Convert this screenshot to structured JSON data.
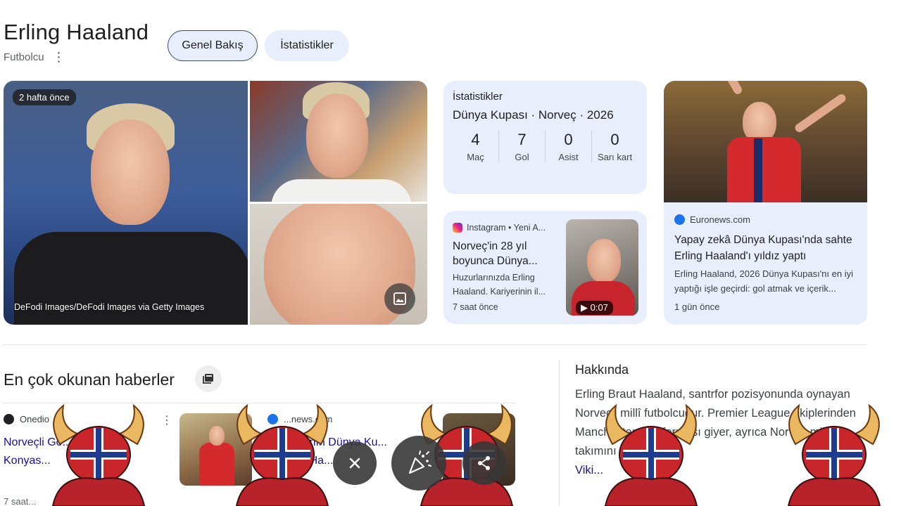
{
  "header": {
    "title": "Erling Haaland",
    "subtitle": "Futbolcu",
    "tabs": [
      {
        "label": "Genel Bakış",
        "active": true
      },
      {
        "label": "İstatistikler",
        "active": false
      }
    ]
  },
  "photos": {
    "time_badge": "2 hafta önce",
    "credit": "DeFodi Images/DeFodi Images via Getty Images"
  },
  "stats": {
    "heading": "İstatistikler",
    "context": "Dünya Kupası · Norveç · 2026",
    "items": [
      {
        "value": "4",
        "label": "Maç"
      },
      {
        "value": "7",
        "label": "Gol"
      },
      {
        "value": "0",
        "label": "Asist"
      },
      {
        "value": "0",
        "label": "Sarı kart"
      }
    ]
  },
  "instagram_card": {
    "source": "Instagram • Yeni A...",
    "title": "Norveç'in 28 yıl boyunca Dünya...",
    "description": "Huzurlarınızda Erling Haaland. Kariyerinin il...",
    "time": "7 saat önce",
    "duration": "0:07"
  },
  "euronews_card": {
    "source": "Euronews.com",
    "title": "Yapay zekâ Dünya Kupası'nda sahte Erling Haaland'ı yıldız yaptı",
    "description": "Erling Haaland, 2026 Dünya Kupası'nı en iyi yaptığı işle geçirdi: gol atmak ve içerik...",
    "time": "1 gün önce"
  },
  "news": {
    "heading": "En çok okunan haberler",
    "items": [
      {
        "source": "Onedio",
        "title": "Norveçli Go... Haaland... Konyas...",
        "time": "7 saat..."
      },
      {
        "source": "...news.com",
        "title": "...y zekânın Dünya Ku... Sahte... Ha..."
      }
    ]
  },
  "about": {
    "heading": "Hakkında",
    "text": "Erling Braut Haaland, santrfor pozisyonunda oynayan Norveçli millî futbolcudur. Premier League ekiplerinden Manchester City forması giyer, ayrıca Norveç millî takımını temsil etm...",
    "link": "Viki..."
  },
  "colors": {
    "card_bg": "#e8eefc",
    "link": "#1a0dab",
    "fab_bg": "#373737"
  },
  "icons": {
    "image": "image-icon",
    "close": "close-icon",
    "party": "party-popper-icon",
    "share": "share-icon"
  }
}
